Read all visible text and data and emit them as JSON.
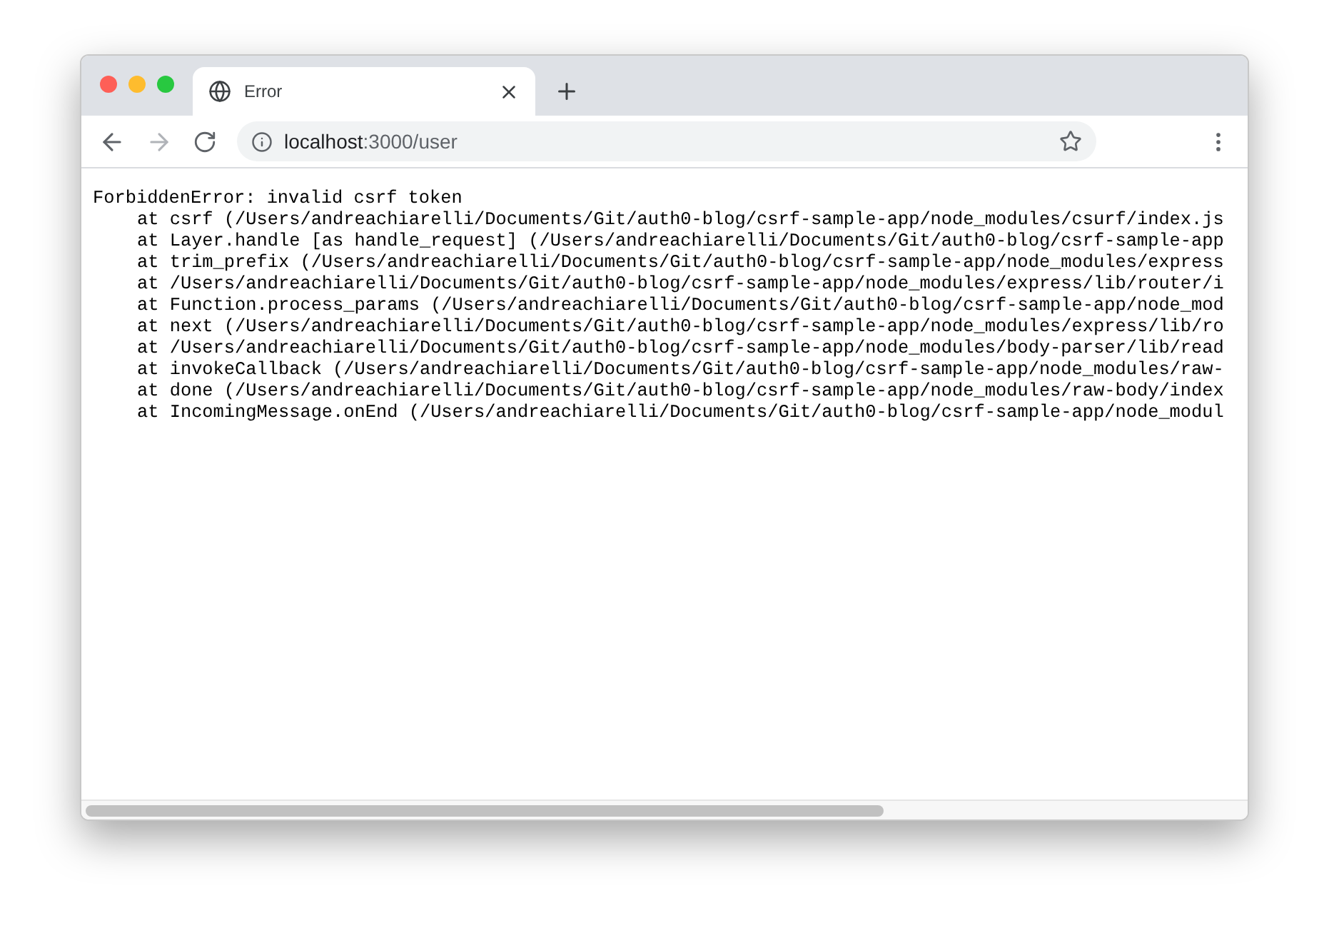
{
  "tab": {
    "title": "Error",
    "selected": true
  },
  "address_bar": {
    "host": "localhost",
    "rest": ":3000/user"
  },
  "error": {
    "message": "ForbiddenError: invalid csrf token",
    "stack": [
      "at csrf (/Users/andreachiarelli/Documents/Git/auth0-blog/csrf-sample-app/node_modules/csurf/index.js",
      "at Layer.handle [as handle_request] (/Users/andreachiarelli/Documents/Git/auth0-blog/csrf-sample-app",
      "at trim_prefix (/Users/andreachiarelli/Documents/Git/auth0-blog/csrf-sample-app/node_modules/express",
      "at /Users/andreachiarelli/Documents/Git/auth0-blog/csrf-sample-app/node_modules/express/lib/router/i",
      "at Function.process_params (/Users/andreachiarelli/Documents/Git/auth0-blog/csrf-sample-app/node_mod",
      "at next (/Users/andreachiarelli/Documents/Git/auth0-blog/csrf-sample-app/node_modules/express/lib/ro",
      "at /Users/andreachiarelli/Documents/Git/auth0-blog/csrf-sample-app/node_modules/body-parser/lib/read",
      "at invokeCallback (/Users/andreachiarelli/Documents/Git/auth0-blog/csrf-sample-app/node_modules/raw-",
      "at done (/Users/andreachiarelli/Documents/Git/auth0-blog/csrf-sample-app/node_modules/raw-body/index",
      "at IncomingMessage.onEnd (/Users/andreachiarelli/Documents/Git/auth0-blog/csrf-sample-app/node_modul"
    ]
  }
}
